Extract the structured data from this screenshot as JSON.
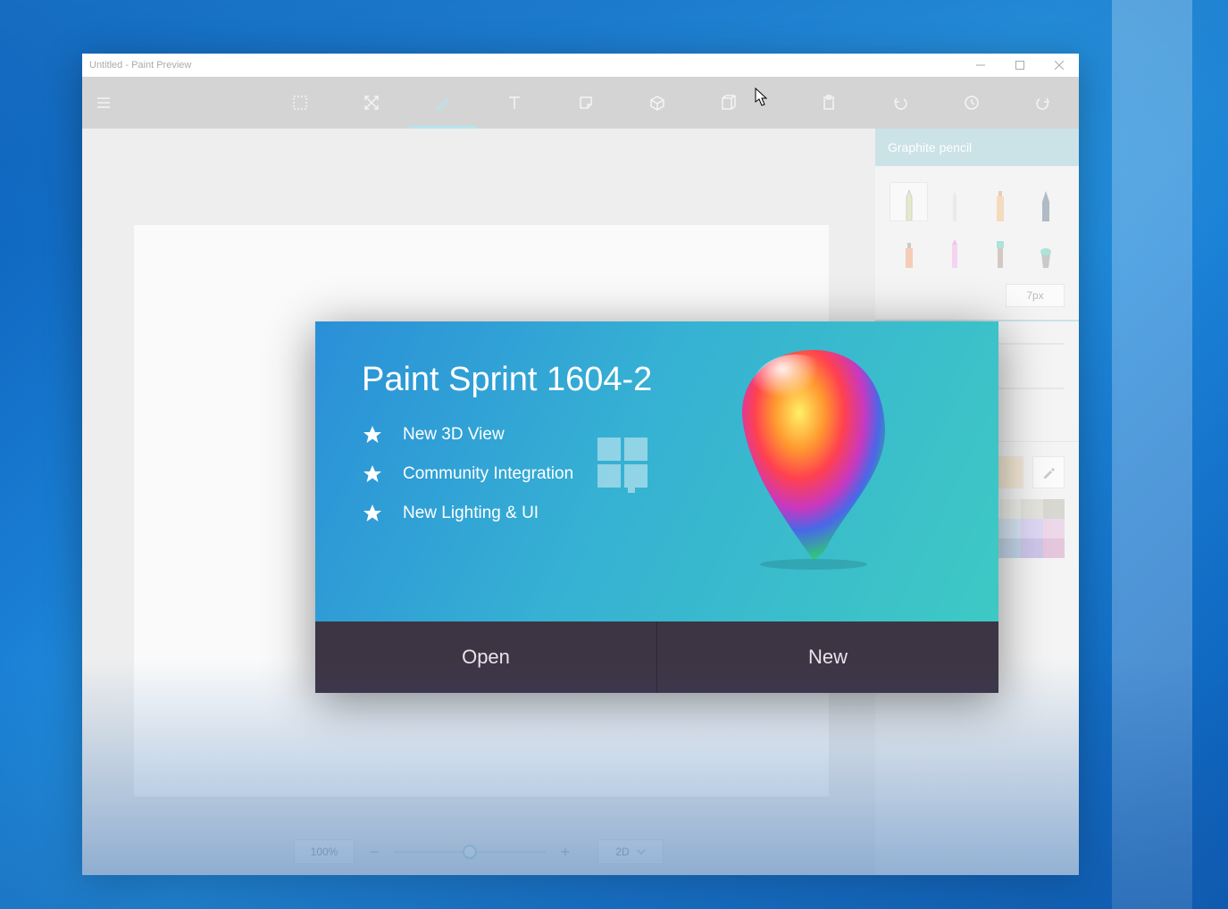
{
  "window": {
    "title": "Untitled - Paint Preview"
  },
  "panel": {
    "title": "Graphite pencil",
    "size": "7px"
  },
  "zoom": {
    "percent": "100%",
    "view_mode": "2D"
  },
  "splash": {
    "title": "Paint Sprint 1604-2",
    "features": [
      "New 3D View",
      "Community Integration",
      "New Lighting & UI"
    ],
    "open": "Open",
    "new": "New"
  },
  "palette": [
    "#8a8a7c",
    "#b9b9a9",
    "#d3d3c5",
    "#e6e6dc",
    "#f0f0e9",
    "#d8d8cd",
    "#c4c4b6",
    "#a8a899",
    "#d89a8a",
    "#e0b89a",
    "#e8d4a8",
    "#c8d8a8",
    "#a8d8c8",
    "#a8c8e8",
    "#b8a8e8",
    "#d8a8d0",
    "#b56a66",
    "#c48a6a",
    "#d4b484",
    "#a6c482",
    "#7cc4ac",
    "#7ca6d0",
    "#9484d0",
    "#c484b4"
  ],
  "current_color": "#e8cfa2"
}
